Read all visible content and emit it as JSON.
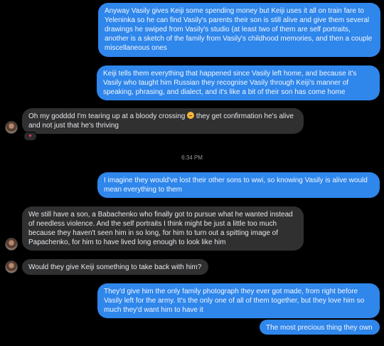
{
  "messages": [
    {
      "text": "Anyway Vasily gives Keiji some spending money but Keiji uses it all on train fare to Yeleninka so he can find Vasily's parents their son is still alive and give them several drawings he swiped from Vasily's studio (at least two of them are self portraits, another is a sketch of the family from Vasily's childhood memories, and then a couple miscellaneous ones"
    },
    {
      "text": "Keiji tells them everything that happened since Vasily left home, and because it's Vasily who taught him Russian they recognise Vasily through Keiji's manner of speaking, phrasing, and dialect, and it's like a bit of their son has come home"
    },
    {
      "text_before_emoji": "Oh my godddd I'm tearing up at a bloody crossing",
      "text_after_emoji": " they get confirmation he's alive and not just that he's thriving",
      "reaction": "♥",
      "emoji_icon": "crying-face-icon"
    },
    {
      "timestamp": "6:34 PM"
    },
    {
      "text": "I imagine they would've lost their other sons to wwi, so knowing Vasily is alive would mean everything to them"
    },
    {
      "text": "We still have a son, a Babachenko who finally got to pursue what he wanted instead of needless violence. And the self portraits I think might be just a little too much because they haven't seen him in so long, for him to turn out a spitting image of Papachenko, for him to have lived long enough to look like him"
    },
    {
      "text": "Would they give Keiji something to take back with him?"
    },
    {
      "text": "They'd give him the only family photograph they ever got made, from right before Vasily left for the army. It's the only one of all of them together, but they love him so much they'd want him to have it"
    },
    {
      "text": "The most precious thing they own"
    }
  ],
  "colors": {
    "outgoing": "#2f86eb",
    "incoming": "#303030",
    "background": "#000000"
  }
}
